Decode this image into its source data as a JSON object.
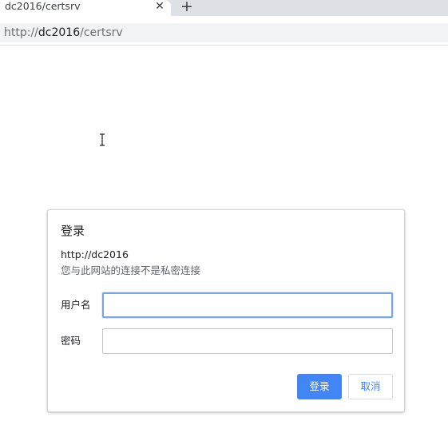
{
  "tab": {
    "title": "dc2016/certsrv",
    "close_icon": "close-icon",
    "new_tab_icon": "plus-icon"
  },
  "address_bar": {
    "scheme": "http://",
    "host": "dc2016",
    "path": "/certsrv"
  },
  "dialog": {
    "title": "登录",
    "origin": "http://dc2016",
    "warning": "您与此网站的连接不是私密连接",
    "username_label": "用户名",
    "username_value": "",
    "password_label": "密码",
    "password_value": "",
    "ok_label": "登录",
    "cancel_label": "取消"
  },
  "colors": {
    "accent": "#4285f4",
    "focus_border": "#7aa3e5"
  }
}
